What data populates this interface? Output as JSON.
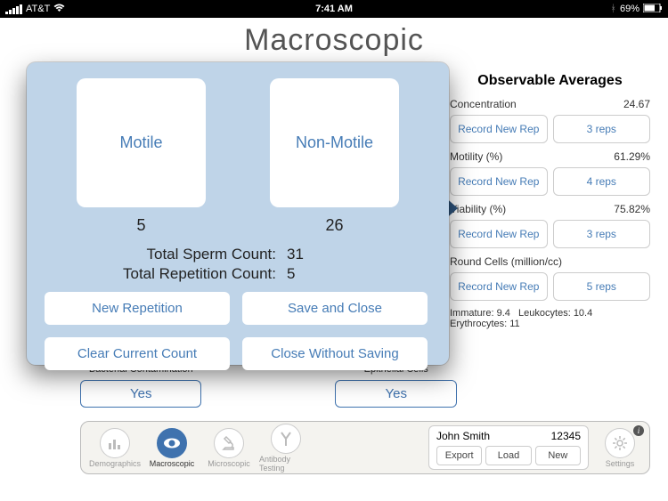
{
  "status": {
    "carrier": "AT&T",
    "time": "7:41 AM",
    "battery": "69%",
    "bt": "✱"
  },
  "page_title": "Macroscopic",
  "averages": {
    "title": "Observable Averages",
    "rows": [
      {
        "label": "Concentration",
        "value": "24.67",
        "record": "Record New Rep",
        "reps": "3 reps"
      },
      {
        "label": "Motility (%)",
        "value": "61.29%",
        "record": "Record New Rep",
        "reps": "4 reps"
      },
      {
        "label": "Viability (%)",
        "value": "75.82%",
        "record": "Record New Rep",
        "reps": "3 reps"
      },
      {
        "label": "Round Cells (million/cc)",
        "value": "",
        "record": "Record New Rep",
        "reps": "5 reps"
      }
    ],
    "footer": {
      "immature_lbl": "Immature:",
      "immature": "9.4",
      "leuko_lbl": "Leukocytes:",
      "leuko": "10.4",
      "eryth_lbl": "Erythrocytes:",
      "eryth": "11"
    }
  },
  "yesno": {
    "bacterial_lbl": "Bacterial Contamination",
    "bacterial": "Yes",
    "epi_lbl": "Epithelial Cells",
    "epi": "Yes"
  },
  "bottom": {
    "tabs": [
      "Demographics",
      "Macroscopic",
      "Microscopic",
      "Antibody Testing"
    ],
    "patient_name": "John Smith",
    "patient_id": "12345",
    "export": "Export",
    "load": "Load",
    "new": "New",
    "settings": "Settings"
  },
  "modal": {
    "motile_lbl": "Motile",
    "motile": "5",
    "nonmotile_lbl": "Non-Motile",
    "nonmotile": "26",
    "total_sperm_lbl": "Total Sperm Count:",
    "total_sperm": "31",
    "total_rep_lbl": "Total Repetition Count:",
    "total_rep": "5",
    "new_rep": "New Repetition",
    "save": "Save and Close",
    "clear": "Clear Current Count",
    "close": "Close Without Saving"
  }
}
